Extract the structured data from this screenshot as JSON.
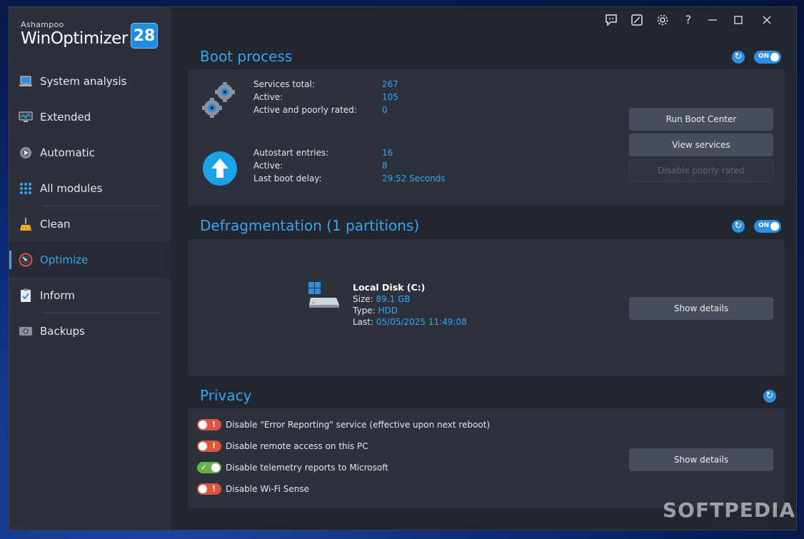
{
  "app": {
    "brand_small": "Ashampoo",
    "brand_name": "WinOptimizer",
    "version_badge": "28"
  },
  "sidebar": {
    "items": [
      {
        "label": "System analysis",
        "icon": "laptop-icon"
      },
      {
        "label": "Extended",
        "icon": "monitor-chart-icon"
      },
      {
        "label": "Automatic",
        "icon": "gear-play-icon"
      },
      {
        "label": "All modules",
        "icon": "grid-icon"
      },
      {
        "label": "Clean",
        "icon": "broom-icon"
      },
      {
        "label": "Optimize",
        "icon": "speedometer-icon",
        "active": true
      },
      {
        "label": "Inform",
        "icon": "clipboard-check-icon"
      },
      {
        "label": "Backups",
        "icon": "hard-drive-icon"
      }
    ]
  },
  "titlebar": {
    "icons": [
      "feedback-icon",
      "skin-icon",
      "settings-icon",
      "help-icon",
      "minimize-icon",
      "maximize-icon",
      "close-icon"
    ]
  },
  "boot": {
    "title": "Boot process",
    "toggle": "ON",
    "services_total_label": "Services total:",
    "services_total": "267",
    "active_label": "Active:",
    "active": "105",
    "poorly_label": "Active and poorly rated:",
    "poorly": "0",
    "autostart_label": "Autostart entries:",
    "autostart": "16",
    "autostart_active_label": "Active:",
    "autostart_active": "8",
    "last_boot_label": "Last boot delay:",
    "last_boot": "29.52 Seconds",
    "btn_run": "Run Boot Center",
    "btn_view": "View services",
    "btn_disable": "Disable poorly rated"
  },
  "defrag": {
    "title": "Defragmentation (1 partitions)",
    "toggle": "ON",
    "disk_name": "Local Disk (C:)",
    "size_label": "Size:",
    "size": "89.1 GB",
    "type_label": "Type:",
    "type": "HDD",
    "last_label": "Last:",
    "last": "05/05/2025 11:49:08",
    "btn_details": "Show details"
  },
  "privacy": {
    "title": "Privacy",
    "items": [
      {
        "label": "Disable \"Error Reporting\" service (effective upon next reboot)",
        "state": "off"
      },
      {
        "label": "Disable remote access on this PC",
        "state": "off"
      },
      {
        "label": "Disable telemetry reports to Microsoft",
        "state": "on"
      },
      {
        "label": "Disable Wi-Fi Sense",
        "state": "off"
      }
    ],
    "btn_details": "Show details"
  },
  "watermark": "SOFTPEDIA",
  "colors": {
    "accent": "#33a6f0",
    "sidebar_bg": "#2b303b",
    "panel_bg": "#2c313c",
    "toggle_off": "#e0533d",
    "toggle_on": "#6ab04c"
  }
}
